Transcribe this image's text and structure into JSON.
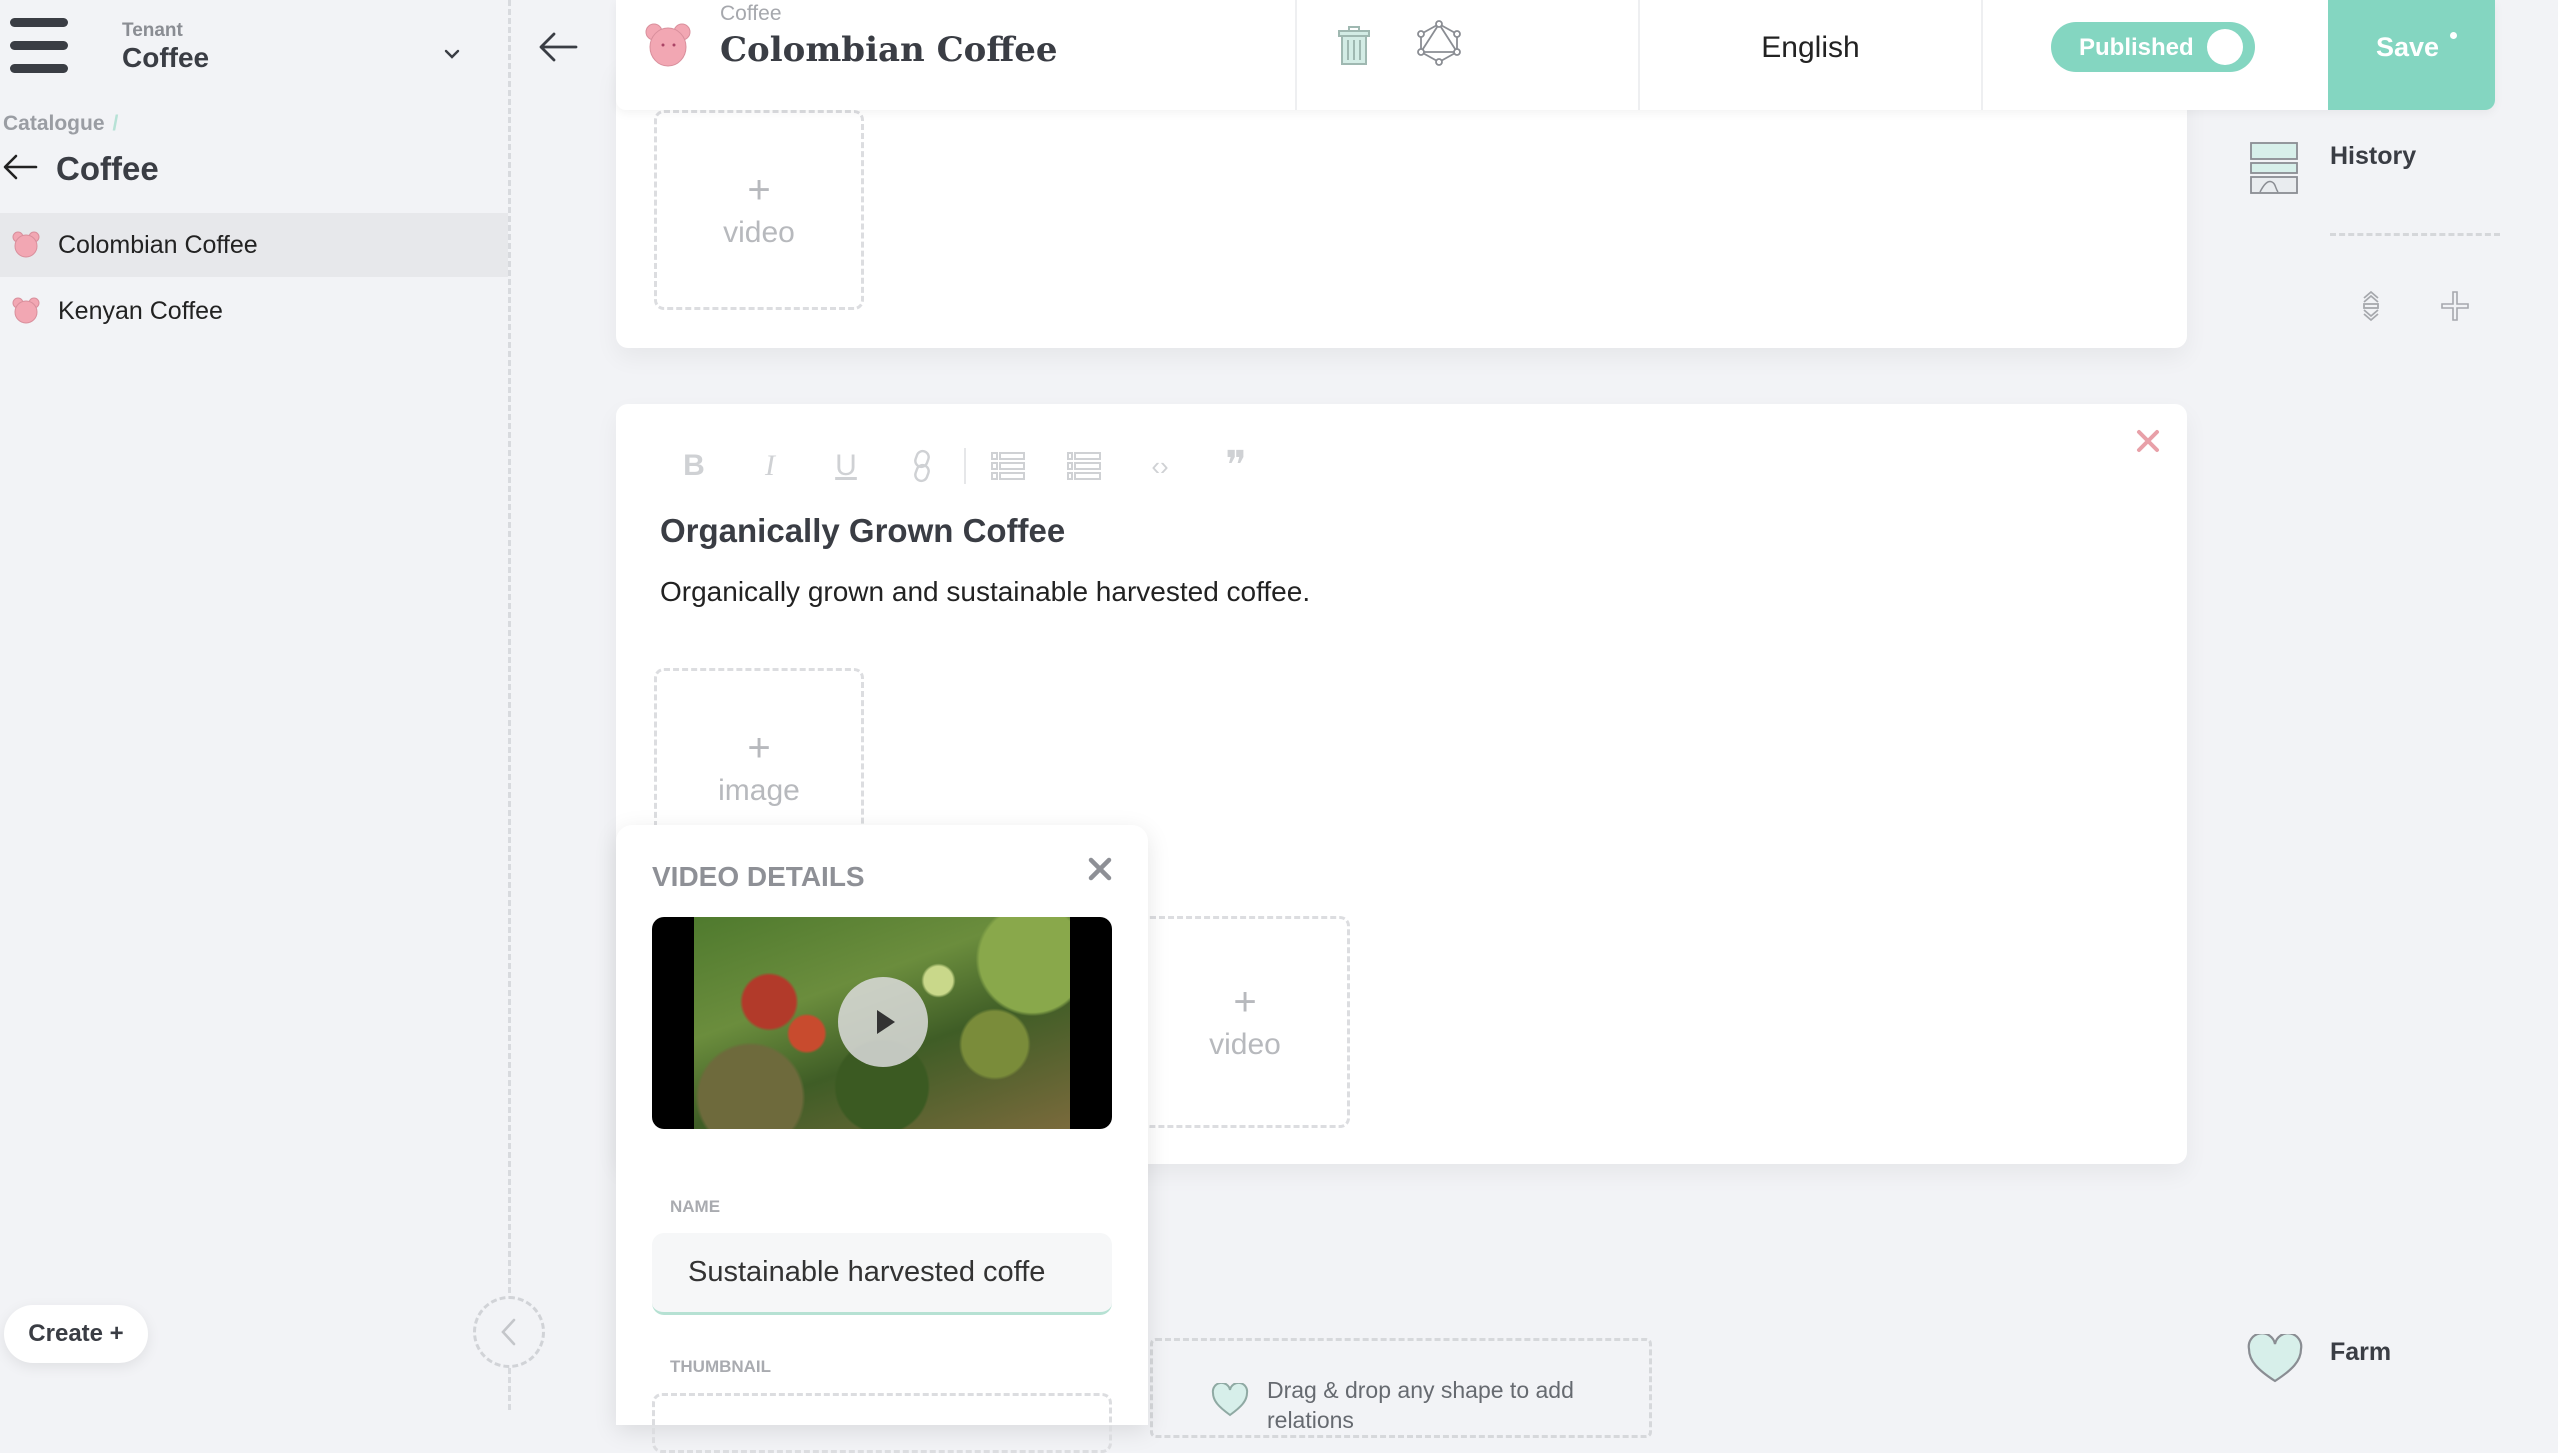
{
  "sidebar": {
    "tenant_label": "Tenant",
    "tenant_value": "Coffee",
    "breadcrumb": {
      "root": "Catalogue",
      "separator": "/"
    },
    "folder_title": "Coffee",
    "items": [
      {
        "label": "Colombian Coffee",
        "icon": "bear-icon",
        "active": true
      },
      {
        "label": "Kenyan Coffee",
        "icon": "bear-icon",
        "active": false
      }
    ],
    "create_label": "Create +"
  },
  "header": {
    "crumb": "Coffee",
    "title": "Colombian Coffee",
    "language": "English",
    "status_label": "Published",
    "status_on": true,
    "save_label": "Save",
    "unsaved_indicator": true
  },
  "card1": {
    "video_placeholder": {
      "plus": "+",
      "label": "video"
    }
  },
  "card2": {
    "toolbar": [
      {
        "name": "bold",
        "glyph": "B"
      },
      {
        "name": "italic",
        "glyph": "I"
      },
      {
        "name": "underline",
        "glyph": "U"
      },
      {
        "name": "link",
        "glyph": "🔗"
      },
      {
        "name": "numbered-list",
        "glyph": "☰"
      },
      {
        "name": "bulleted-list",
        "glyph": "☰"
      },
      {
        "name": "code",
        "glyph": "‹›"
      },
      {
        "name": "quote",
        "glyph": "❞"
      }
    ],
    "heading": "Organically Grown Coffee",
    "paragraph": "Organically grown and sustainable harvested coffee.",
    "image_placeholder": {
      "plus": "+",
      "label": "image"
    },
    "video_placeholder": {
      "plus": "+",
      "label": "video"
    }
  },
  "video_details": {
    "title": "VIDEO DETAILS",
    "name_label": "NAME",
    "name_value": "Sustainable harvested coffe",
    "thumbnail_label": "THUMBNAIL"
  },
  "shape_drop": {
    "text": "Drag & drop any shape to add relations"
  },
  "right_panel": {
    "history_label": "History",
    "farm_label": "Farm"
  },
  "colors": {
    "accent": "#84d6c1",
    "background": "#f2f3f6",
    "bear": "#f2a7b3",
    "close_red": "#e8a0a8"
  }
}
